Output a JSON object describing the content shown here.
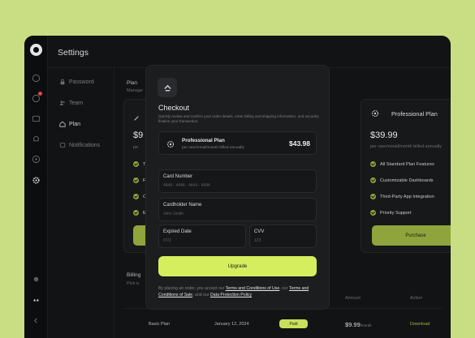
{
  "app": {
    "title": "Settings"
  },
  "settings_nav": [
    {
      "label": "Password",
      "icon": "lock-icon"
    },
    {
      "label": "Team",
      "icon": "team-icon"
    },
    {
      "label": "Plan",
      "icon": "plan-icon"
    },
    {
      "label": "Notifications",
      "icon": "bell-icon"
    }
  ],
  "plan_section": {
    "title": "Plan",
    "subtitle": "Manage"
  },
  "left_card": {
    "price": "$9",
    "features": [
      "T",
      "F",
      "C",
      "E"
    ]
  },
  "right_card": {
    "name": "Professional Plan",
    "price": "$39.99",
    "price_sub": "per user/email/month billed annually",
    "features": [
      "All Standard Plan Features",
      "Customizable Dashboards",
      "Third-Party App Integration",
      "Priority Support"
    ],
    "button_label": "Purchase"
  },
  "billing": {
    "title": "Billing",
    "subtitle": "Pick a",
    "headers": [
      "Amount",
      "Action"
    ],
    "row": {
      "plan": "Basic Plan",
      "date": "January 12, 2024",
      "status": "Paid",
      "amount": "$9.99",
      "amount_unit": "/month",
      "action": "Download"
    }
  },
  "modal": {
    "title": "Checkout",
    "description": "Quickly review and confirm your order details, enter billing and shipping information, and securely finalize your transaction.",
    "plan": {
      "name": "Professional Plan",
      "sub": "per user/email/month billed annually",
      "price": "$43.98"
    },
    "fields": {
      "card_number": {
        "label": "Card Number",
        "placeholder": "4444 - 4444 - 4444 - 4444"
      },
      "cardholder": {
        "label": "Cardholder Name",
        "placeholder": "John Smith"
      },
      "expired": {
        "label": "Expired Date",
        "placeholder": "07/2"
      },
      "cvv": {
        "label": "CVV",
        "placeholder": "123"
      }
    },
    "upgrade_label": "Upgrade",
    "terms": {
      "prefix": "By placing an order, you accept our ",
      "link1": "Terms and Conditions of Use",
      "mid": ", our ",
      "link2": "Terms and Conditions of Sale",
      "mid2": ", and our ",
      "link3": "Data Protection Policy"
    }
  },
  "colors": {
    "accent": "#d4ee5e",
    "background": "#c9de82",
    "panel": "#121314",
    "modal": "#1c1d1f"
  }
}
